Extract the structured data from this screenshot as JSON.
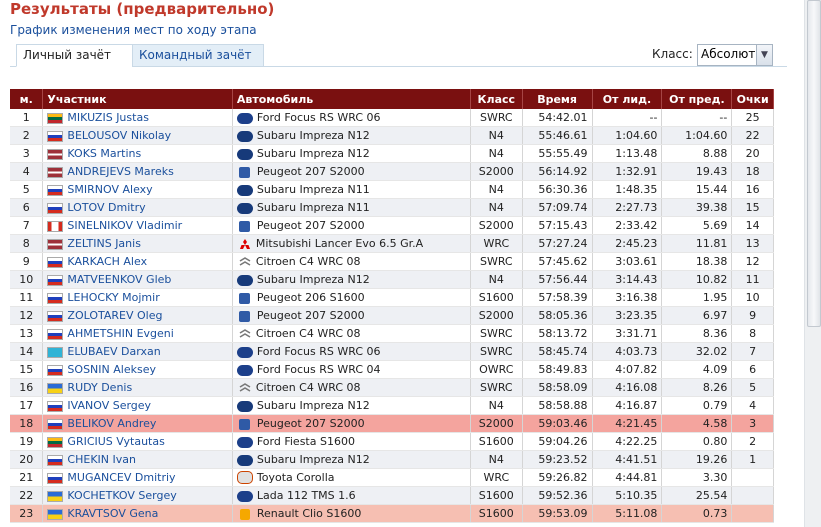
{
  "page": {
    "title": "Результаты (предварительно)",
    "link_text": "График изменения мест по ходу этапа",
    "tabs": [
      "Личный зачёт",
      "Командный зачёт"
    ],
    "class_label": "Класс:",
    "class_value": "Абсолют"
  },
  "headers": [
    "м.",
    "Участник",
    "Автомобиль",
    "Класс",
    "Время",
    "От лид.",
    "От пред.",
    "Очки"
  ],
  "rows": [
    {
      "pos": "1",
      "flag": "lt",
      "name": "MIKUZIS Justas",
      "logo": "ford",
      "car": "Ford Focus RS WRC 06",
      "cls": "SWRC",
      "time": "54:42.01",
      "lead": "--",
      "prev": "--",
      "pts": "25"
    },
    {
      "pos": "2",
      "flag": "ru",
      "name": "BELOUSOV Nikolay",
      "logo": "subaru",
      "car": "Subaru Impreza N12",
      "cls": "N4",
      "time": "55:46.61",
      "lead": "1:04.60",
      "prev": "1:04.60",
      "pts": "22"
    },
    {
      "pos": "3",
      "flag": "lv",
      "name": "KOKS Martins",
      "logo": "subaru",
      "car": "Subaru Impreza N12",
      "cls": "N4",
      "time": "55:55.49",
      "lead": "1:13.48",
      "prev": "8.88",
      "pts": "20"
    },
    {
      "pos": "4",
      "flag": "lv",
      "name": "ANDREJEVS Mareks",
      "logo": "peugeot",
      "car": "Peugeot 207 S2000",
      "cls": "S2000",
      "time": "56:14.92",
      "lead": "1:32.91",
      "prev": "19.43",
      "pts": "18"
    },
    {
      "pos": "5",
      "flag": "ru",
      "name": "SMIRNOV Alexy",
      "logo": "subaru",
      "car": "Subaru Impreza N11",
      "cls": "N4",
      "time": "56:30.36",
      "lead": "1:48.35",
      "prev": "15.44",
      "pts": "16"
    },
    {
      "pos": "6",
      "flag": "ru",
      "name": "LOTOV Dmitry",
      "logo": "subaru",
      "car": "Subaru Impreza N11",
      "cls": "N4",
      "time": "57:09.74",
      "lead": "2:27.73",
      "prev": "39.38",
      "pts": "15"
    },
    {
      "pos": "7",
      "flag": "ca",
      "name": "SINELNIKOV Vladimir",
      "logo": "peugeot",
      "car": "Peugeot 207 S2000",
      "cls": "S2000",
      "time": "57:15.43",
      "lead": "2:33.42",
      "prev": "5.69",
      "pts": "14"
    },
    {
      "pos": "8",
      "flag": "lv",
      "name": "ZELTINS Janis",
      "logo": "mitsubishi",
      "car": "Mitsubishi Lancer Evo 6.5 Gr.A",
      "cls": "WRC",
      "time": "57:27.24",
      "lead": "2:45.23",
      "prev": "11.81",
      "pts": "13"
    },
    {
      "pos": "9",
      "flag": "ru",
      "name": "KARKACH Alex",
      "logo": "citroen",
      "car": "Citroen C4 WRC 08",
      "cls": "SWRC",
      "time": "57:45.62",
      "lead": "3:03.61",
      "prev": "18.38",
      "pts": "12"
    },
    {
      "pos": "10",
      "flag": "ru",
      "name": "MATVEENKOV Gleb",
      "logo": "subaru",
      "car": "Subaru Impreza N12",
      "cls": "N4",
      "time": "57:56.44",
      "lead": "3:14.43",
      "prev": "10.82",
      "pts": "11"
    },
    {
      "pos": "11",
      "flag": "sk",
      "name": "LEHOCKY Mojmir",
      "logo": "peugeot",
      "car": "Peugeot 206 S1600",
      "cls": "S1600",
      "time": "57:58.39",
      "lead": "3:16.38",
      "prev": "1.95",
      "pts": "10"
    },
    {
      "pos": "12",
      "flag": "ru",
      "name": "ZOLOTAREV Oleg",
      "logo": "peugeot",
      "car": "Peugeot 207 S2000",
      "cls": "S2000",
      "time": "58:05.36",
      "lead": "3:23.35",
      "prev": "6.97",
      "pts": "9"
    },
    {
      "pos": "13",
      "flag": "ru",
      "name": "AHMETSHIN Evgeni",
      "logo": "citroen",
      "car": "Citroen C4 WRC 08",
      "cls": "SWRC",
      "time": "58:13.72",
      "lead": "3:31.71",
      "prev": "8.36",
      "pts": "8"
    },
    {
      "pos": "14",
      "flag": "kz",
      "name": "ELUBAEV Darxan",
      "logo": "ford",
      "car": "Ford Focus RS WRC 06",
      "cls": "SWRC",
      "time": "58:45.74",
      "lead": "4:03.73",
      "prev": "32.02",
      "pts": "7"
    },
    {
      "pos": "15",
      "flag": "ru",
      "name": "SOSNIN Aleksey",
      "logo": "ford",
      "car": "Ford Focus RS WRC 04",
      "cls": "OWRC",
      "time": "58:49.83",
      "lead": "4:07.82",
      "prev": "4.09",
      "pts": "6"
    },
    {
      "pos": "16",
      "flag": "ua",
      "name": "RUDY Denis",
      "logo": "citroen",
      "car": "Citroen C4 WRC 08",
      "cls": "SWRC",
      "time": "58:58.09",
      "lead": "4:16.08",
      "prev": "8.26",
      "pts": "5"
    },
    {
      "pos": "17",
      "flag": "ru",
      "name": "IVANOV Sergey",
      "logo": "subaru",
      "car": "Subaru Impreza N12",
      "cls": "N4",
      "time": "58:58.88",
      "lead": "4:16.87",
      "prev": "0.79",
      "pts": "4"
    },
    {
      "pos": "18",
      "flag": "ru",
      "name": "BELIKOV Andrey",
      "logo": "peugeot",
      "car": "Peugeot 207 S2000",
      "cls": "S2000",
      "time": "59:03.46",
      "lead": "4:21.45",
      "prev": "4.58",
      "pts": "3",
      "hl": "1"
    },
    {
      "pos": "19",
      "flag": "lt",
      "name": "GRICIUS Vytautas",
      "logo": "ford",
      "car": "Ford Fiesta S1600",
      "cls": "S1600",
      "time": "59:04.26",
      "lead": "4:22.25",
      "prev": "0.80",
      "pts": "2"
    },
    {
      "pos": "20",
      "flag": "ru",
      "name": "CHEKIN Ivan",
      "logo": "subaru",
      "car": "Subaru Impreza N12",
      "cls": "N4",
      "time": "59:23.52",
      "lead": "4:41.51",
      "prev": "19.26",
      "pts": "1"
    },
    {
      "pos": "21",
      "flag": "ru",
      "name": "MUGANCEV Dmitriy",
      "logo": "toyota",
      "car": "Toyota Corolla",
      "cls": "WRC",
      "time": "59:26.82",
      "lead": "4:44.81",
      "prev": "3.30",
      "pts": ""
    },
    {
      "pos": "22",
      "flag": "ua",
      "name": "KOCHETKOV Sergey",
      "logo": "lada",
      "car": "Lada 112 TMS 1.6",
      "cls": "S1600",
      "time": "59:52.36",
      "lead": "5:10.35",
      "prev": "25.54",
      "pts": ""
    },
    {
      "pos": "23",
      "flag": "ua",
      "name": "KRAVTSOV Gena",
      "logo": "renault",
      "car": "Renault Clio S1600",
      "cls": "S1600",
      "time": "59:53.09",
      "lead": "5:11.08",
      "prev": "0.73",
      "pts": "",
      "hl": "2"
    }
  ]
}
